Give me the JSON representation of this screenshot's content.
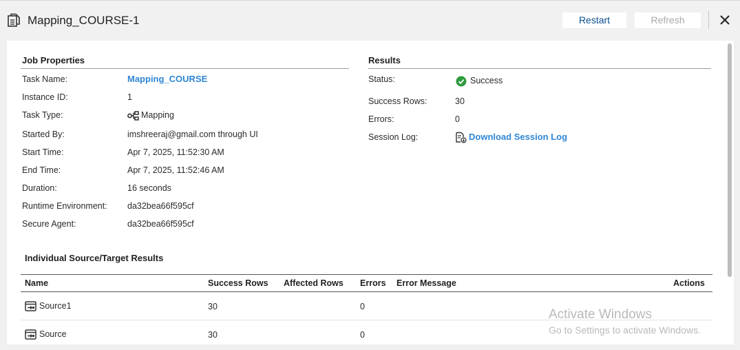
{
  "window": {
    "title": "Mapping_COURSE-1",
    "restart_label": "Restart",
    "refresh_label": "Refresh"
  },
  "job_properties": {
    "heading": "Job Properties",
    "fields": [
      {
        "label": "Task Name:",
        "value": "Mapping_COURSE"
      },
      {
        "label": "Instance ID:",
        "value": "1"
      },
      {
        "label": "Task Type:",
        "value": "Mapping",
        "icon": "mapping-icon"
      },
      {
        "label": "Started By:",
        "value": "imshreeraj@gmail.com through UI"
      },
      {
        "label": "Start Time:",
        "value": "Apr 7, 2025, 11:52:30 AM"
      },
      {
        "label": "End Time:",
        "value": "Apr 7, 2025, 11:52:46 AM"
      },
      {
        "label": "Duration:",
        "value": "16 seconds"
      },
      {
        "label": "Runtime Environment:",
        "value": "da32bea66f595cf"
      },
      {
        "label": "Secure Agent:",
        "value": "da32bea66f595cf"
      }
    ]
  },
  "results": {
    "heading": "Results",
    "status_label": "Status:",
    "status_value": "Success",
    "status_icon": "check-circle-icon",
    "success_rows_label": "Success Rows:",
    "success_rows_value": "30",
    "errors_label": "Errors:",
    "errors_value": "0",
    "session_log_label": "Session Log:",
    "session_log_link": "Download Session Log",
    "session_log_icon": "download-log-icon"
  },
  "source_target": {
    "heading": "Individual Source/Target Results",
    "columns": [
      "Name",
      "Success Rows",
      "Affected Rows",
      "Errors",
      "Error Message",
      "Actions"
    ],
    "rows": [
      {
        "name": "Source1",
        "success_rows": "30",
        "affected_rows": "",
        "errors": "0",
        "error_message": ""
      },
      {
        "name": "Source",
        "success_rows": "30",
        "affected_rows": "",
        "errors": "0",
        "error_message": ""
      }
    ]
  },
  "watermark": {
    "line1": "Activate Windows",
    "line2": "Go to Settings to activate Windows."
  },
  "colors": {
    "accent_link": "#2f86d6",
    "restart_text": "#0a4f8f",
    "success_green": "#2e9b3e"
  }
}
